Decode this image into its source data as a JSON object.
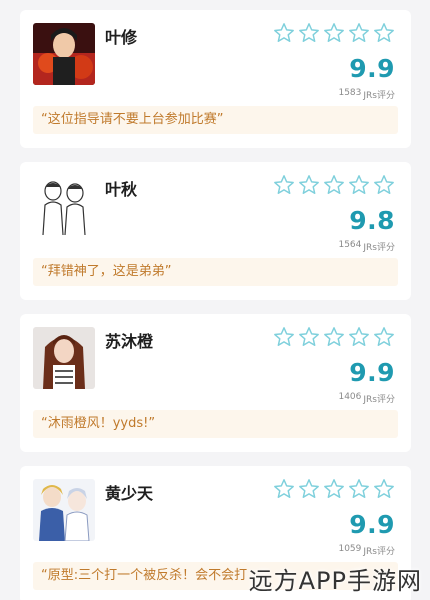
{
  "items": [
    {
      "name": "叶修",
      "score": "9.9",
      "count": "1583",
      "unit": "JRs评分",
      "comment": "“这位指导请不要上台参加比赛”"
    },
    {
      "name": "叶秋",
      "score": "9.8",
      "count": "1564",
      "unit": "JRs评分",
      "comment": "“拜错神了，这是弟弟”"
    },
    {
      "name": "苏沐橙",
      "score": "9.9",
      "count": "1406",
      "unit": "JRs评分",
      "comment": "“沐雨橙风！yyds!”"
    },
    {
      "name": "黄少天",
      "score": "9.9",
      "count": "1059",
      "unit": "JRs评分",
      "comment": "“原型:三个打一个被反杀！会不会打"
    }
  ],
  "watermark": "远方APP手游网",
  "colors": {
    "accent": "#1f9ab0",
    "star_outline": "#7fd0dc",
    "comment_text": "#c07a2c",
    "comment_bg": "#fdf6ec"
  },
  "icons": {
    "star": "star-outline-icon"
  }
}
